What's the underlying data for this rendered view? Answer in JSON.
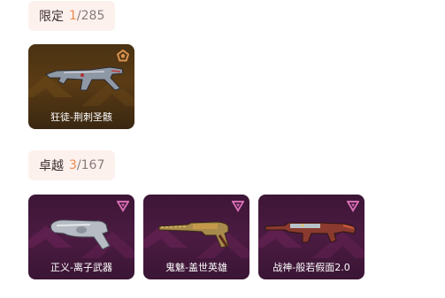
{
  "sections": [
    {
      "title": "限定",
      "count": "1",
      "total": "/285",
      "items": [
        {
          "name": "狂徒-荆刺圣骸",
          "rarity_icon": "pentagon-emblem-icon",
          "weapon_icon": "vandal-rifle-icon",
          "theme": "gold"
        }
      ]
    },
    {
      "title": "卓越",
      "count": "3",
      "total": "/167",
      "items": [
        {
          "name": "正义-离子武器",
          "rarity_icon": "triangle-down-icon",
          "weapon_icon": "sheriff-pistol-icon",
          "theme": "purple"
        },
        {
          "name": "鬼魅-盖世英雄",
          "rarity_icon": "triangle-down-icon",
          "weapon_icon": "ghost-pistol-icon",
          "theme": "purple"
        },
        {
          "name": "战神-般若假面2.0",
          "rarity_icon": "triangle-down-icon",
          "weapon_icon": "ares-rifle-icon",
          "theme": "purple"
        }
      ]
    }
  ],
  "colors": {
    "header_bg": "#fdf1ee",
    "count_accent": "#f08a4b",
    "gold_card": "#4a3213",
    "purple_card": "#3d1636",
    "rarity_gold": "#d8924f",
    "rarity_purple": "#d46bb0"
  }
}
